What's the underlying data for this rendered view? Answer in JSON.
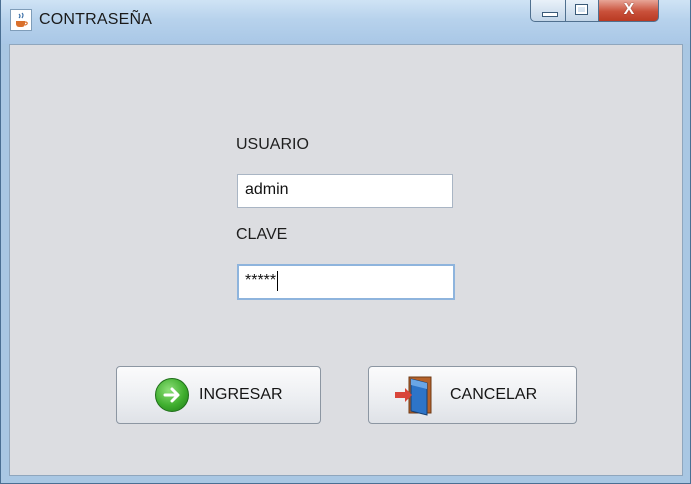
{
  "window": {
    "title": "CONTRASEÑA",
    "controls": {
      "close": "X"
    }
  },
  "form": {
    "usuario_label": "USUARIO",
    "usuario_value": "admin",
    "clave_label": "CLAVE",
    "clave_value": "*****"
  },
  "buttons": {
    "ingresar": "INGRESAR",
    "cancelar": "CANCELAR"
  },
  "icons": {
    "title": "java-cup-icon",
    "ingresar": "arrow-right-circle-icon",
    "cancelar": "exit-door-icon"
  }
}
